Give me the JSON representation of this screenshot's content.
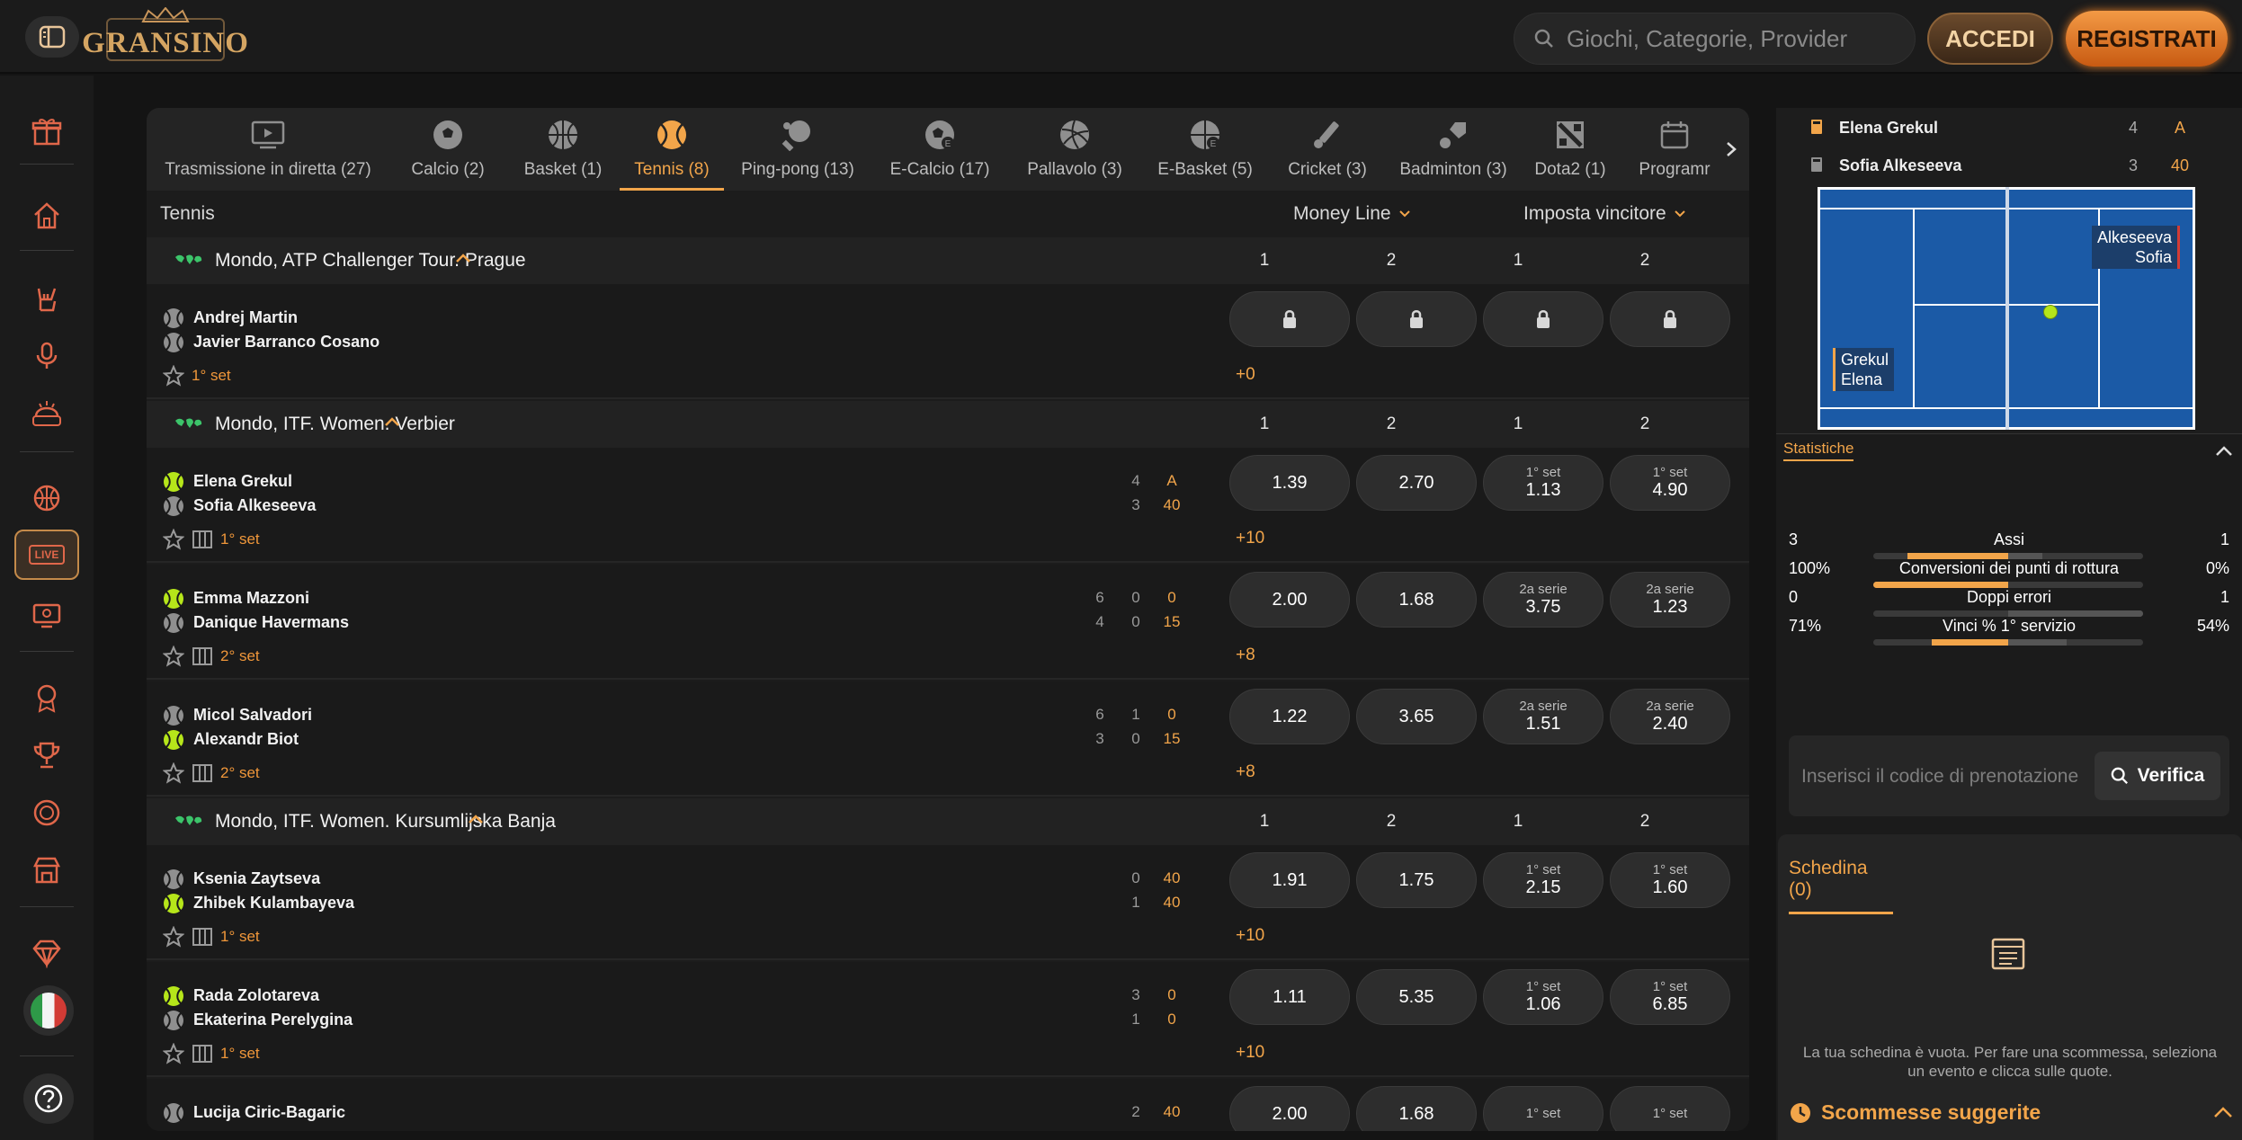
{
  "brand": {
    "logo_text": "GRANSINO"
  },
  "header": {
    "search_placeholder": "Giochi, Categorie, Provider",
    "login_label": "ACCEDI",
    "register_label": "REGISTRATI"
  },
  "sidebar": {
    "live_label": "LIVE"
  },
  "tabs": [
    {
      "label": "Trasmissione in diretta (27)",
      "icon": "tv-icon"
    },
    {
      "label": "Calcio (2)",
      "icon": "soccer-icon"
    },
    {
      "label": "Basket (1)",
      "icon": "basketball-icon"
    },
    {
      "label": "Tennis (8)",
      "icon": "tennis-icon",
      "active": true
    },
    {
      "label": "Ping-pong (13)",
      "icon": "pingpong-icon"
    },
    {
      "label": "E-Calcio (17)",
      "icon": "esoccer-icon"
    },
    {
      "label": "Pallavolo (3)",
      "icon": "volleyball-icon"
    },
    {
      "label": "E-Basket (5)",
      "icon": "ebasketball-icon"
    },
    {
      "label": "Cricket (3)",
      "icon": "cricket-icon"
    },
    {
      "label": "Badminton (3)",
      "icon": "badminton-icon"
    },
    {
      "label": "Dota2 (1)",
      "icon": "dota-icon"
    },
    {
      "label": "Programr",
      "icon": "calendar-icon"
    }
  ],
  "table": {
    "sport": "Tennis",
    "market1": "Money Line",
    "market2": "Imposta vincitore",
    "cols": [
      "1",
      "2",
      "1",
      "2"
    ]
  },
  "leagues": [
    {
      "name": "Mondo, ATP Challenger Tour. Prague"
    },
    {
      "name": "Mondo, ITF. Women. Verbier"
    },
    {
      "name": "Mondo, ITF. Women. Kursumlijska Banja"
    }
  ],
  "matches": [
    {
      "p1": "Andrej Martin",
      "p2": "Javier Barranco Cosano",
      "set": "1° set",
      "more": "+0",
      "locked": true
    },
    {
      "p1": "Elena Grekul",
      "p2": "Sofia Alkeseeva",
      "set": "1° set",
      "more": "+10",
      "s1": [
        "4",
        "A"
      ],
      "s2": [
        "3",
        "40"
      ],
      "serve": 1,
      "odds": [
        {
          "v": "1.39"
        },
        {
          "v": "2.70"
        },
        {
          "t": "1° set",
          "v": "1.13"
        },
        {
          "t": "1° set",
          "v": "4.90"
        }
      ]
    },
    {
      "p1": "Emma Mazzoni",
      "p2": "Danique Havermans",
      "set": "2° set",
      "more": "+8",
      "s1": [
        "6",
        "0",
        "0"
      ],
      "s2": [
        "4",
        "0",
        "15"
      ],
      "serve": 1,
      "odds": [
        {
          "v": "2.00"
        },
        {
          "v": "1.68"
        },
        {
          "t": "2a serie",
          "v": "3.75"
        },
        {
          "t": "2a serie",
          "v": "1.23"
        }
      ]
    },
    {
      "p1": "Micol Salvadori",
      "p2": "Alexandr Biot",
      "set": "2° set",
      "more": "+8",
      "s1": [
        "6",
        "1",
        "0"
      ],
      "s2": [
        "3",
        "0",
        "15"
      ],
      "serve": 2,
      "odds": [
        {
          "v": "1.22"
        },
        {
          "v": "3.65"
        },
        {
          "t": "2a serie",
          "v": "1.51"
        },
        {
          "t": "2a serie",
          "v": "2.40"
        }
      ]
    },
    {
      "p1": "Ksenia Zaytseva",
      "p2": "Zhibek Kulambayeva",
      "set": "1° set",
      "more": "+10",
      "s1": [
        "0",
        "40"
      ],
      "s2": [
        "1",
        "40"
      ],
      "serve": 2,
      "odds": [
        {
          "v": "1.91"
        },
        {
          "v": "1.75"
        },
        {
          "t": "1° set",
          "v": "2.15"
        },
        {
          "t": "1° set",
          "v": "1.60"
        }
      ]
    },
    {
      "p1": "Rada Zolotareva",
      "p2": "Ekaterina Perelygina",
      "set": "1° set",
      "more": "+10",
      "s1": [
        "3",
        "0"
      ],
      "s2": [
        "1",
        "0"
      ],
      "serve": 1,
      "odds": [
        {
          "v": "1.11"
        },
        {
          "v": "5.35"
        },
        {
          "t": "1° set",
          "v": "1.06"
        },
        {
          "t": "1° set",
          "v": "6.85"
        }
      ]
    },
    {
      "p1": "Lucija Ciric-Bagaric",
      "s1": [
        "2",
        "40"
      ],
      "odds": [
        {
          "v": "2.00"
        },
        {
          "v": "1.68"
        },
        {
          "t": "1° set"
        },
        {
          "t": "1° set"
        }
      ]
    }
  ],
  "live_panel": {
    "p1": "Elena Grekul",
    "p2": "Sofia Alkeseeva",
    "p1_score": [
      "4",
      "A"
    ],
    "p2_score": [
      "3",
      "40"
    ],
    "court_right_name": [
      "Alkeseeva",
      "Sofia"
    ],
    "court_left_name": [
      "Grekul",
      "Elena"
    ]
  },
  "stats": {
    "title": "Statistiche",
    "rows": [
      {
        "label": "Assi",
        "left": "3",
        "right": "1",
        "left_share": 0.75
      },
      {
        "label": "Conversioni dei punti di rottura",
        "left": "100%",
        "right": "0%",
        "left_share": 1.0
      },
      {
        "label": "Doppi errori",
        "left": "0",
        "right": "1",
        "left_share": 0.0
      },
      {
        "label": "Vinci % 1° servizio",
        "left": "71%",
        "right": "54%",
        "left_share": 0.57
      }
    ]
  },
  "booking": {
    "placeholder": "Inserisci il codice di prenotazione",
    "button": "Verifica"
  },
  "betslip": {
    "tab": "Schedina (0)",
    "empty_text": "La tua schedina è vuota. Per fare una scommessa, seleziona un evento e clicca sulle quote.",
    "suggested": "Scommesse suggerite"
  },
  "colors": {
    "accent": "#f2a54a",
    "court": "#1b5aa6",
    "ball": "#b6e61a"
  }
}
